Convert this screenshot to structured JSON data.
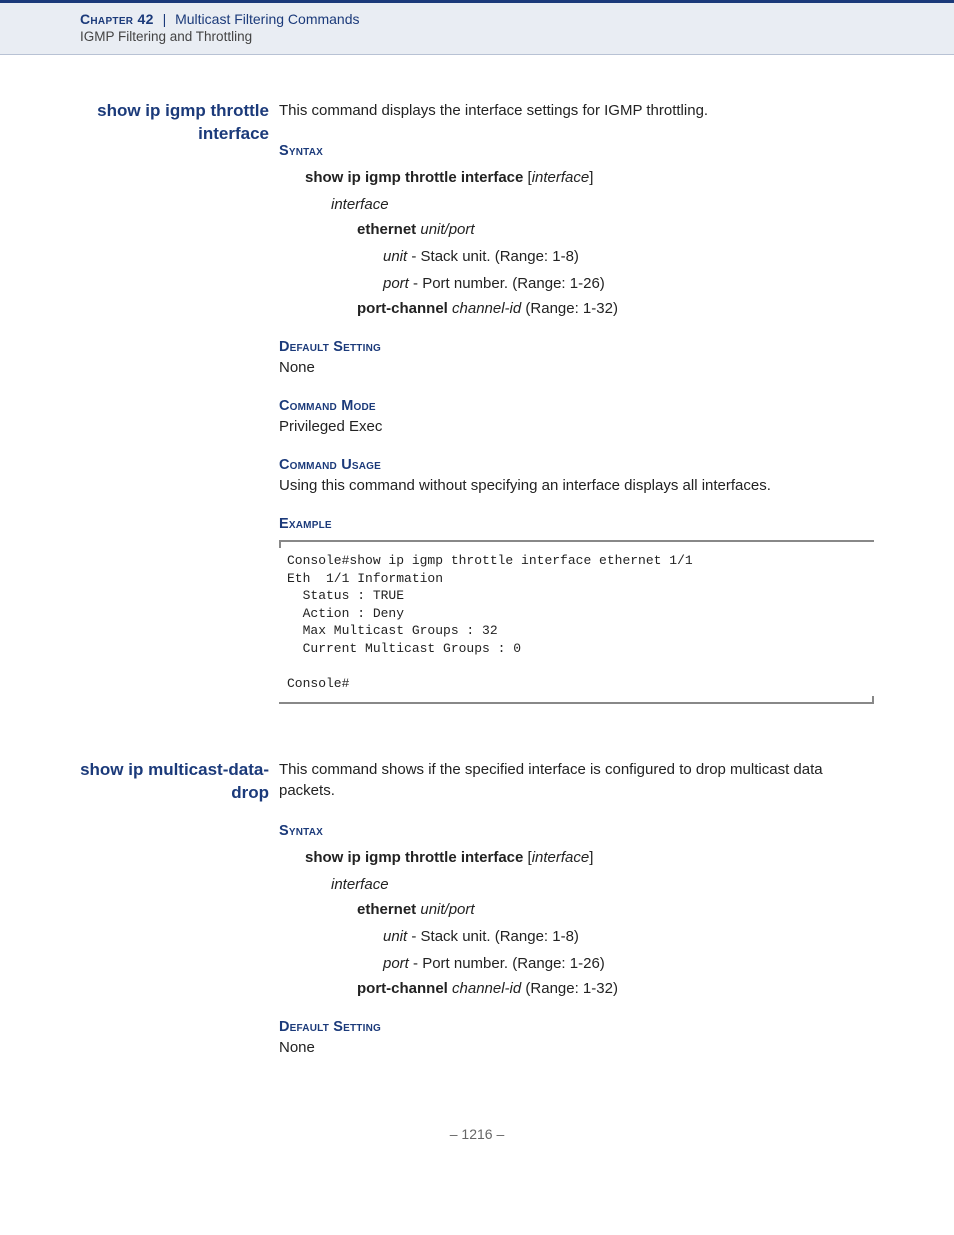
{
  "header": {
    "chapter": "Chapter 42",
    "separator": "|",
    "section": "Multicast Filtering Commands",
    "subsection": "IGMP Filtering and Throttling"
  },
  "entries": [
    {
      "title": "show ip igmp throttle interface",
      "description": "This command displays the interface settings for IGMP throttling.",
      "syntax": {
        "heading": "Syntax",
        "line_bold": "show ip igmp throttle interface",
        "line_param": "interface",
        "interface_label": "interface",
        "eth_bold": "ethernet",
        "eth_params": "unit/port",
        "unit_label": "unit",
        "unit_desc": " - Stack unit. (Range: 1-8)",
        "port_label": "port",
        "port_desc": " - Port number. (Range: 1-26)",
        "pc_bold": "port-channel",
        "pc_param": "channel-id",
        "pc_desc": " (Range: 1-32)"
      },
      "default_heading": "Default Setting",
      "default_value": "None",
      "mode_heading": "Command Mode",
      "mode_value": "Privileged Exec",
      "usage_heading": "Command Usage",
      "usage_value": "Using this command without specifying an interface displays all interfaces.",
      "example_heading": "Example",
      "example_text": "Console#show ip igmp throttle interface ethernet 1/1\nEth  1/1 Information\n  Status : TRUE\n  Action : Deny\n  Max Multicast Groups : 32\n  Current Multicast Groups : 0\n\nConsole#"
    },
    {
      "title": "show ip multicast-data-drop",
      "description": "This command shows if the specified interface is configured to drop multicast data packets.",
      "syntax": {
        "heading": "Syntax",
        "line_bold": "show ip igmp throttle interface",
        "line_param": "interface",
        "interface_label": "interface",
        "eth_bold": "ethernet",
        "eth_params": "unit/port",
        "unit_label": "unit",
        "unit_desc": " - Stack unit. (Range: 1-8)",
        "port_label": "port",
        "port_desc": " - Port number. (Range: 1-26)",
        "pc_bold": "port-channel",
        "pc_param": "channel-id",
        "pc_desc": " (Range: 1-32)"
      },
      "default_heading": "Default Setting",
      "default_value": "None"
    }
  ],
  "page_number": "–  1216  –"
}
